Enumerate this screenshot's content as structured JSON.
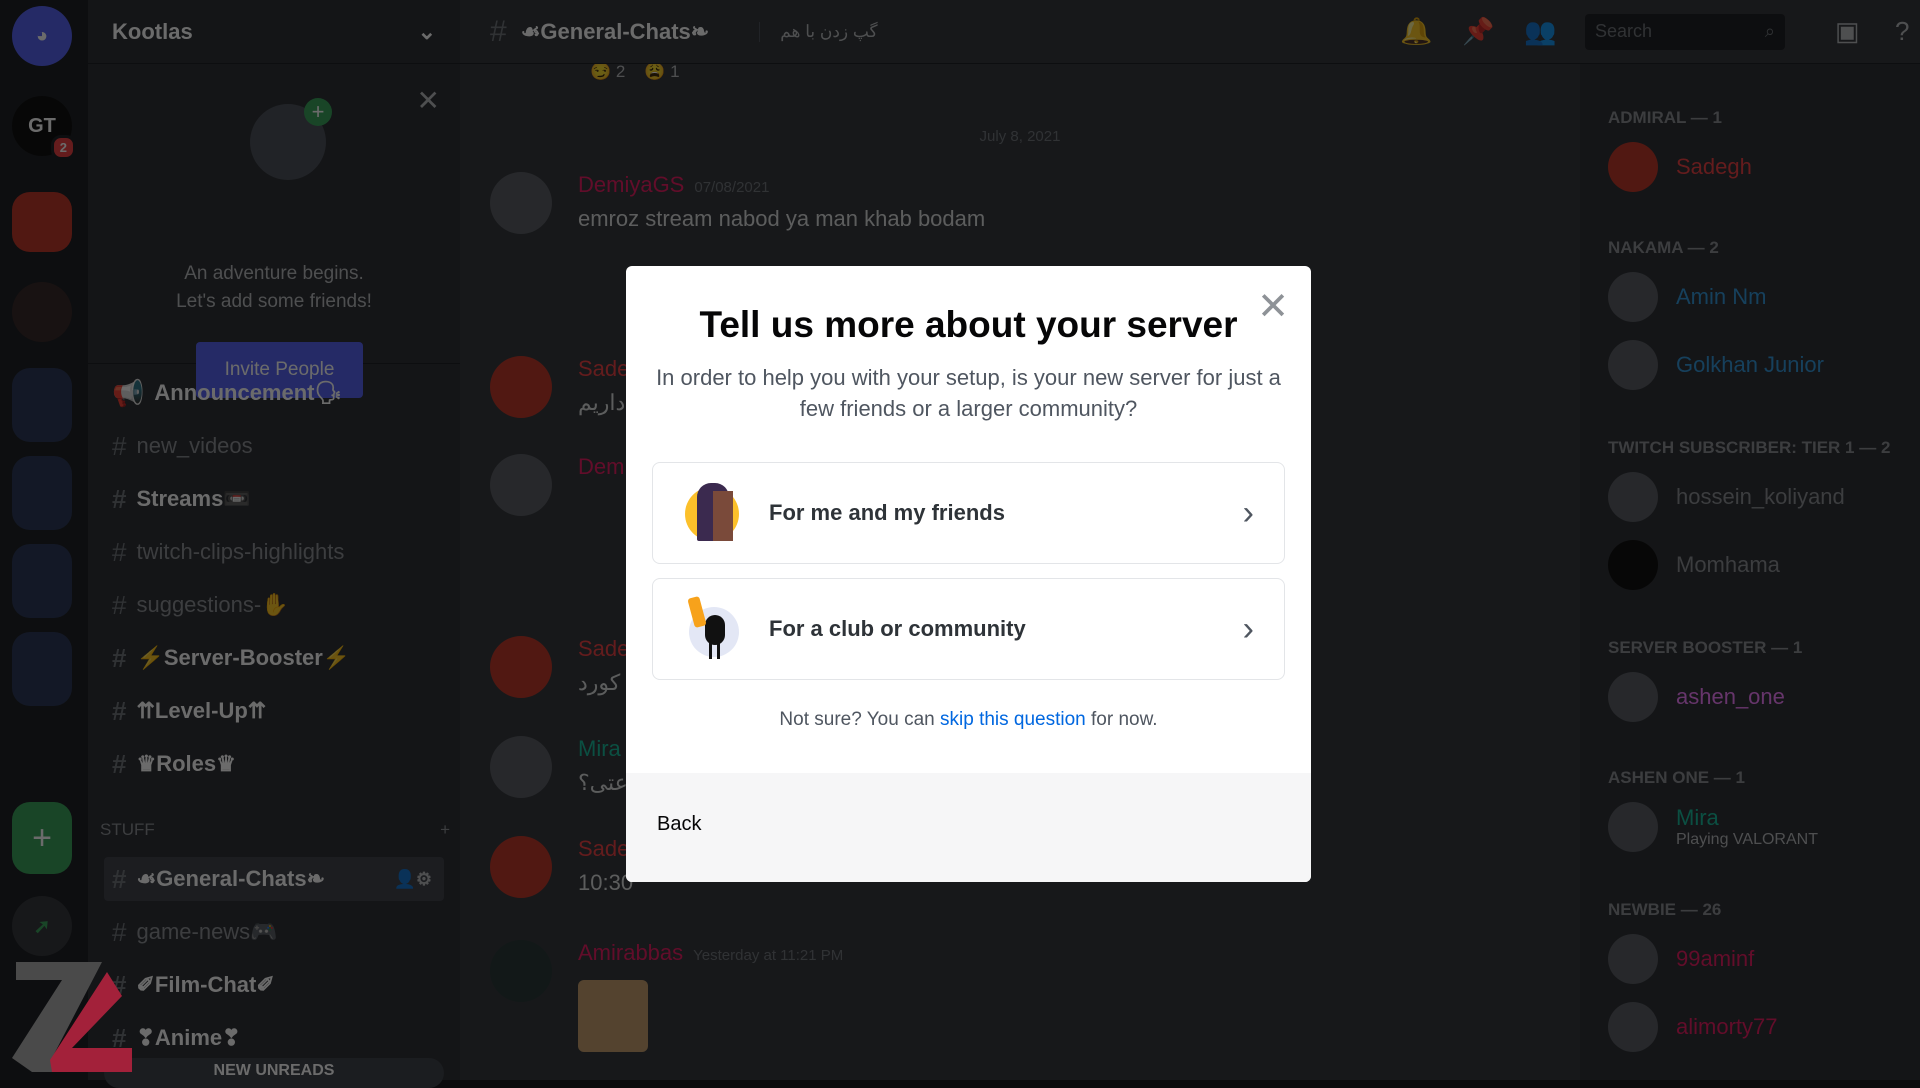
{
  "rail": {
    "gt_badge": "2",
    "add_label": "+"
  },
  "server": {
    "name": "Kootlas"
  },
  "welcome": {
    "line1": "An adventure begins.",
    "line2": "Let's add some friends!",
    "invite_label": "Invite People"
  },
  "channels": [
    {
      "name": "Announcement🗣",
      "bold": true
    },
    {
      "name": "new_videos"
    },
    {
      "name": "Streams📼",
      "bold": true
    },
    {
      "name": "twitch-clips-highlights"
    },
    {
      "name": "suggestions-✋"
    },
    {
      "name": "⚡Server-Booster⚡",
      "bold": true
    },
    {
      "name": "⇈Level-Up⇈",
      "bold": true
    },
    {
      "name": "♛Roles♛",
      "bold": true
    }
  ],
  "category": {
    "name": "STUFF"
  },
  "stuff_channels": [
    {
      "name": "☙General-Chats❧",
      "selected": true
    },
    {
      "name": "game-news🎮"
    },
    {
      "name": "✐Film-Chat✐",
      "bold": true
    },
    {
      "name": "❣Anime❣",
      "bold": true
    }
  ],
  "new_unreads": "NEW UNREADS",
  "header": {
    "channel": "☙General-Chats❧",
    "topic": "گپ زدن با هم",
    "search_placeholder": "Search"
  },
  "chat": {
    "date_divider": "July 8, 2021",
    "reactions": [
      {
        "count": "2"
      },
      {
        "count": "1"
      }
    ],
    "messages": [
      {
        "author": "DemiyaGS",
        "time": "07/08/2021",
        "text": "emroz stream nabod ya man khab bodam",
        "color": "#e91e63"
      },
      {
        "author": "Sade",
        "time": "",
        "text": "داریم",
        "color": "#ed4245"
      },
      {
        "author": "Dem",
        "time": "",
        "text": "",
        "color": "#e91e63"
      },
      {
        "author": "Sade",
        "time": "",
        "text": "کورد",
        "color": "#ed4245"
      },
      {
        "author": "Mira",
        "time": "",
        "text": "اعتی؟",
        "color": "#1abc9c"
      },
      {
        "author": "Sade",
        "time": "",
        "text": "10:30",
        "color": "#ed4245"
      },
      {
        "author": "Amirabbas",
        "time": "Yesterday at 11:21 PM",
        "text": "",
        "color": "#e91e63"
      }
    ]
  },
  "members": {
    "groups": [
      {
        "title": "ADMIRAL — 1",
        "members": [
          {
            "name": "Sadegh",
            "color": "#ed4245"
          }
        ]
      },
      {
        "title": "NAKAMA — 2",
        "members": [
          {
            "name": "Amin Nm",
            "color": "#3498db"
          },
          {
            "name": "Golkhan Junior",
            "color": "#3498db"
          }
        ]
      },
      {
        "title": "TWITCH SUBSCRIBER: TIER 1 — 2",
        "members": [
          {
            "name": "hossein_koliyand",
            "color": "#8e9297"
          },
          {
            "name": "Momhama",
            "color": "#8e9297"
          }
        ]
      },
      {
        "title": "SERVER BOOSTER — 1",
        "members": [
          {
            "name": "ashen_one",
            "color": "#f47fff"
          }
        ]
      },
      {
        "title": "ASHEN ONE — 1",
        "members": [
          {
            "name": "Mira",
            "color": "#1abc9c",
            "status": "Playing VALORANT"
          }
        ]
      },
      {
        "title": "NEWBIE — 26",
        "members": [
          {
            "name": "99aminf",
            "color": "#e91e63"
          },
          {
            "name": "alimorty77",
            "color": "#e91e63"
          }
        ]
      }
    ]
  },
  "modal": {
    "title": "Tell us more about your server",
    "subtitle": "In order to help you with your setup, is your new server for just a few friends or a larger community?",
    "options": [
      {
        "label": "For me and my friends",
        "icon": "door-moon-illustration"
      },
      {
        "label": "For a club or community",
        "icon": "foam-finger-illustration"
      }
    ],
    "skip_prefix": "Not sure? You can ",
    "skip_link": "skip this question",
    "skip_suffix": " for now.",
    "back_label": "Back",
    "link_color": "#0067e0"
  }
}
